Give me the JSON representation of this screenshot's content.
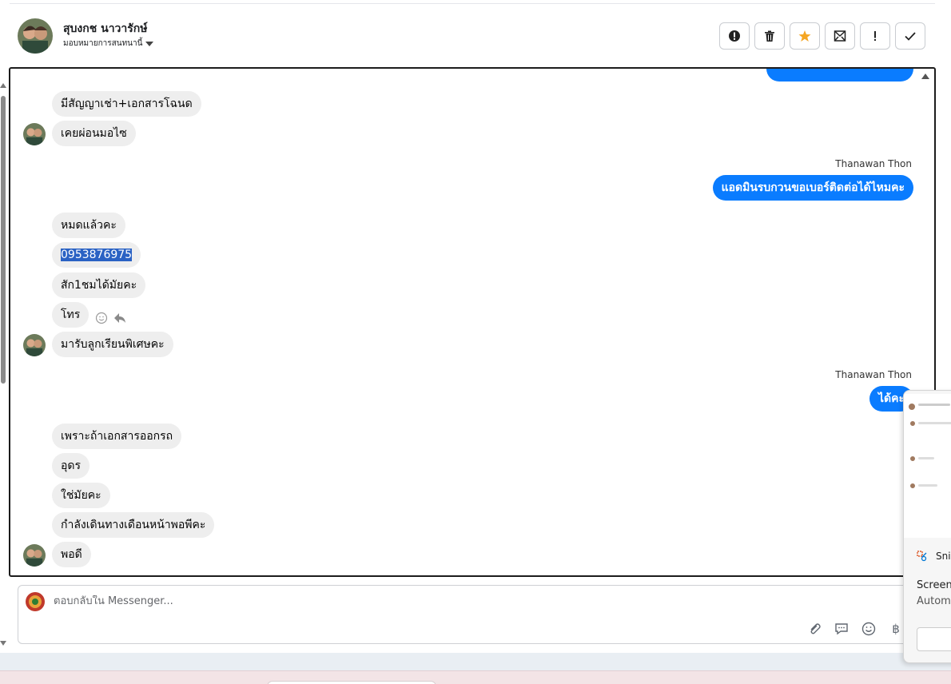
{
  "header": {
    "name": "สุบงกช นาวารักษ์",
    "assign_label": "มอบหมายการสนทนานี้",
    "toolbar": [
      {
        "id": "spam",
        "icon": "alert-circle-icon"
      },
      {
        "id": "delete",
        "icon": "trash-icon"
      },
      {
        "id": "star",
        "icon": "star-icon"
      },
      {
        "id": "unread",
        "icon": "mail-icon"
      },
      {
        "id": "important",
        "icon": "exclamation-icon"
      },
      {
        "id": "done",
        "icon": "check-icon"
      }
    ]
  },
  "conversation": {
    "selected_text": "0953876975",
    "messages": [
      {
        "dir": "in",
        "text": "มีสัญญาเช่า+เอกสารโฉนด"
      },
      {
        "dir": "in",
        "text": "เคยผ่อนมอไซ"
      },
      {
        "dir": "out",
        "sender": "Thanawan Thon",
        "text": "แอดมินรบกวนขอเบอร์ติดต่อได้ไหมคะ"
      },
      {
        "dir": "in",
        "text": "หมดแล้วคะ"
      },
      {
        "dir": "in",
        "text": "0953876975"
      },
      {
        "dir": "in",
        "text": "สัก1ชมได้มัยคะ"
      },
      {
        "dir": "in",
        "text": "โทร"
      },
      {
        "dir": "in",
        "text": "มารับลูกเรียนพิเศษคะ"
      },
      {
        "dir": "out",
        "sender": "Thanawan Thon",
        "text": "ได้คะ"
      },
      {
        "dir": "in",
        "text": "เพราะถ้าเอกสารออกรถ"
      },
      {
        "dir": "in",
        "text": "อุดร"
      },
      {
        "dir": "in",
        "text": "ใช่มัยคะ"
      },
      {
        "dir": "in",
        "text": "กำลังเดินทางเดือนหน้าพอพีคะ"
      },
      {
        "dir": "in",
        "text": "พอดี"
      }
    ]
  },
  "reply": {
    "placeholder": "ตอบกลับใน Messenger...",
    "icons": [
      "paperclip-icon",
      "chat-bubble-icon",
      "emoji-icon",
      "baht-icon"
    ]
  },
  "snip_popup": {
    "app": "Snip",
    "title": "Screens",
    "subtitle": "Automa"
  },
  "colors": {
    "outgoing": "#0a7cff",
    "incoming": "#eeeeee",
    "selection": "#2a62c4",
    "star": "#f5a623"
  }
}
